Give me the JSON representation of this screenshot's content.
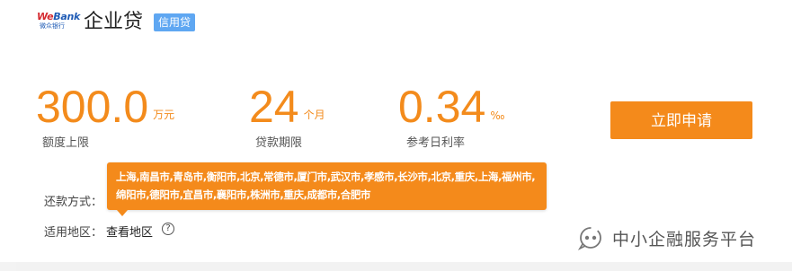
{
  "header": {
    "logo_brand_we": "We",
    "logo_brand_bank": "Bank",
    "logo_sub": "微众银行",
    "title": "企业贷",
    "tag": "信用贷"
  },
  "stats": {
    "amount": {
      "value": "300.0",
      "unit": "万元",
      "label": "额度上限"
    },
    "term": {
      "value": "24",
      "unit": "个月",
      "label": "贷款期限"
    },
    "rate": {
      "value": "0.34",
      "unit": "‰",
      "label": "参考日利率"
    }
  },
  "apply_button": "立即申请",
  "details": {
    "repay_label": "还款方式：",
    "region_label": "适用地区：",
    "region_link": "查看地区",
    "help_glyph": "?"
  },
  "tooltip": {
    "text": "上海,南昌市,青岛市,衡阳市,北京,常德市,厦门市,武汉市,孝感市,长沙市,北京,重庆,上海,福州市,绵阳市,德阳市,宜昌市,襄阳市,株洲市,重庆,成都市,合肥市"
  },
  "watermark": {
    "text": "中小企融服务平台",
    "icon": "wechat-public-account-icon"
  },
  "colors": {
    "accent": "#f48a1b",
    "tag_blue": "#5fa7f2",
    "logo_blue": "#1f5bb5",
    "logo_red": "#d4282e"
  }
}
